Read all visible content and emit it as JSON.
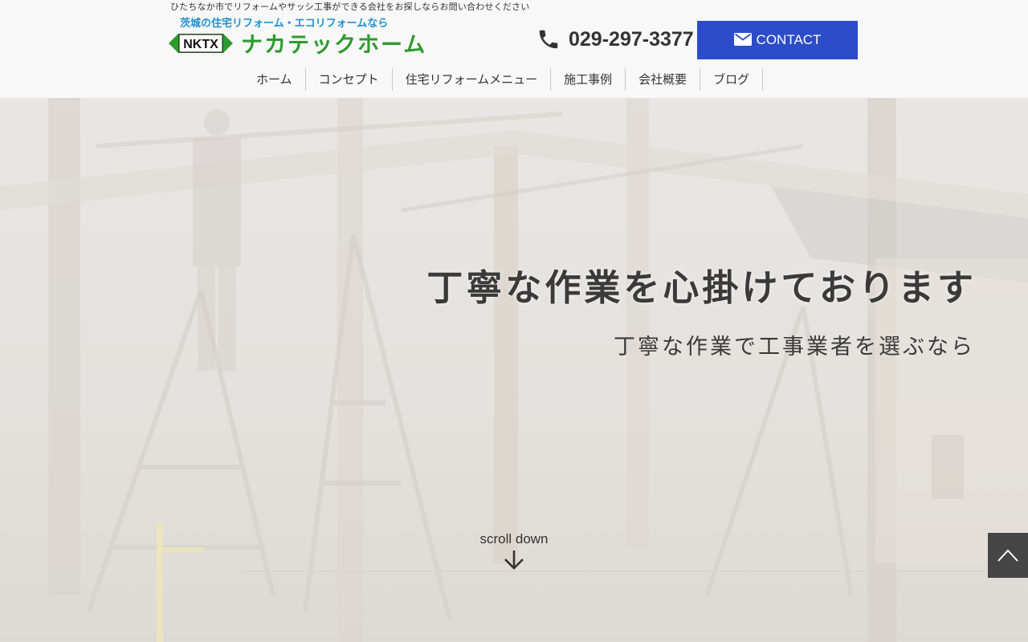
{
  "header": {
    "tagline": "ひたちなか市でリフォームやサッシ工事ができる会社をお探しならお問い合わせください",
    "logo": {
      "subtitle": "茨城の住宅リフォーム・エコリフォームなら",
      "mark_text": "NKTX",
      "name": "ナカテックホーム"
    },
    "phone": "029-297-3377",
    "contact_label": "CONTACT"
  },
  "nav": {
    "items": [
      {
        "label": "ホーム"
      },
      {
        "label": "コンセプト"
      },
      {
        "label": "住宅リフォームメニュー"
      },
      {
        "label": "施工事例"
      },
      {
        "label": "会社概要"
      },
      {
        "label": "ブログ"
      }
    ]
  },
  "hero": {
    "title": "丁寧な作業を心掛けております",
    "subtitle": "丁寧な作業で工事業者を選ぶなら",
    "scroll_label": "scroll down"
  },
  "icons": {
    "phone": "phone-icon",
    "mail": "mail-icon",
    "scroll": "arrow-down-icon",
    "page_top": "chevron-up-icon"
  },
  "colors": {
    "accent_blue": "#2c4cc8",
    "logo_green": "#2e9a2e",
    "logo_blue": "#1f8fcf",
    "page_top_bg": "#454545"
  }
}
